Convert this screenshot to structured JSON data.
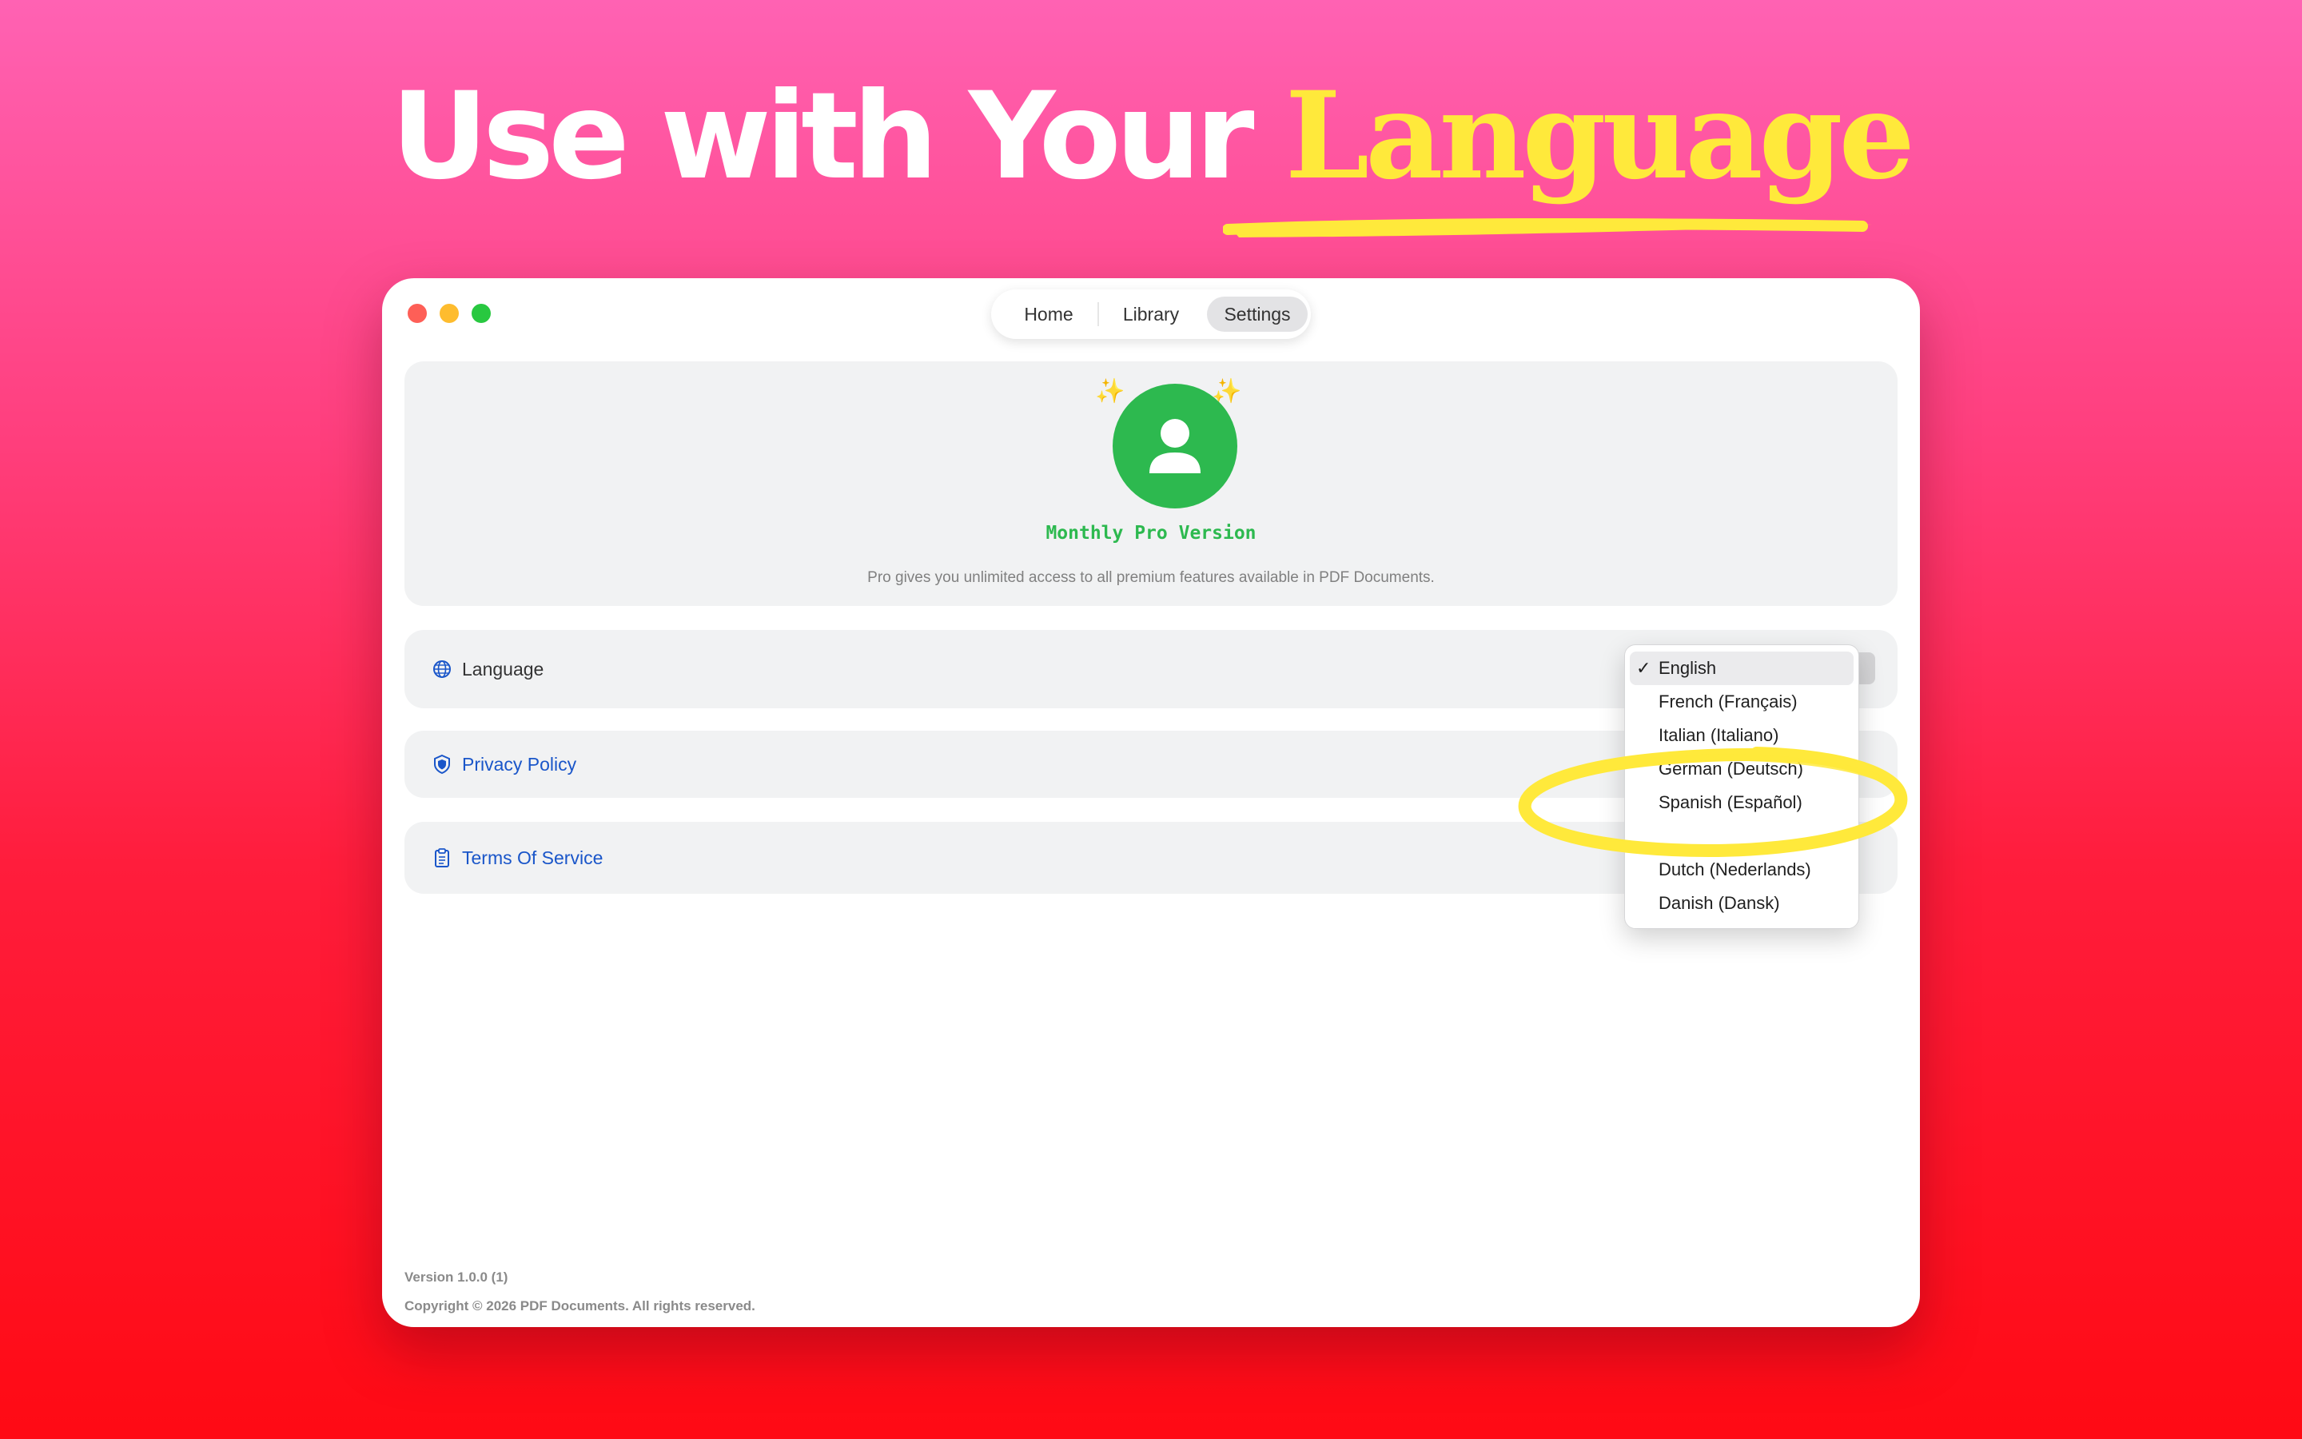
{
  "headline": {
    "prefix": "Use with Your ",
    "accent": "Language"
  },
  "colors": {
    "accent_yellow": "#ffe93b",
    "brand_green": "#2db94f",
    "link_blue": "#1a56c9"
  },
  "window": {
    "controls": [
      "close",
      "minimize",
      "zoom"
    ],
    "nav": {
      "items": [
        "Home",
        "Library",
        "Settings"
      ],
      "selected": "Settings"
    }
  },
  "pro": {
    "icon": "person-icon",
    "title": "Monthly Pro Version",
    "description": "Pro gives you unlimited access to all premium features available in PDF Documents."
  },
  "settings": {
    "language": {
      "icon": "globe-icon",
      "label": "Language"
    },
    "privacy": {
      "icon": "shield-icon",
      "label": "Privacy Policy"
    },
    "terms": {
      "icon": "clipboard-icon",
      "label": "Terms Of Service"
    }
  },
  "language_menu": {
    "selected": "English",
    "options": [
      "English",
      "French (Français)",
      "Italian (Italiano)",
      "German (Deutsch)",
      "Spanish (Español)",
      "Dutch (Nederlands)",
      "Danish (Dansk)"
    ],
    "check": "✓"
  },
  "footer": {
    "version": "Version 1.0.0 (1)",
    "copyright": "Copyright © 2026 PDF Documents. All rights reserved."
  }
}
